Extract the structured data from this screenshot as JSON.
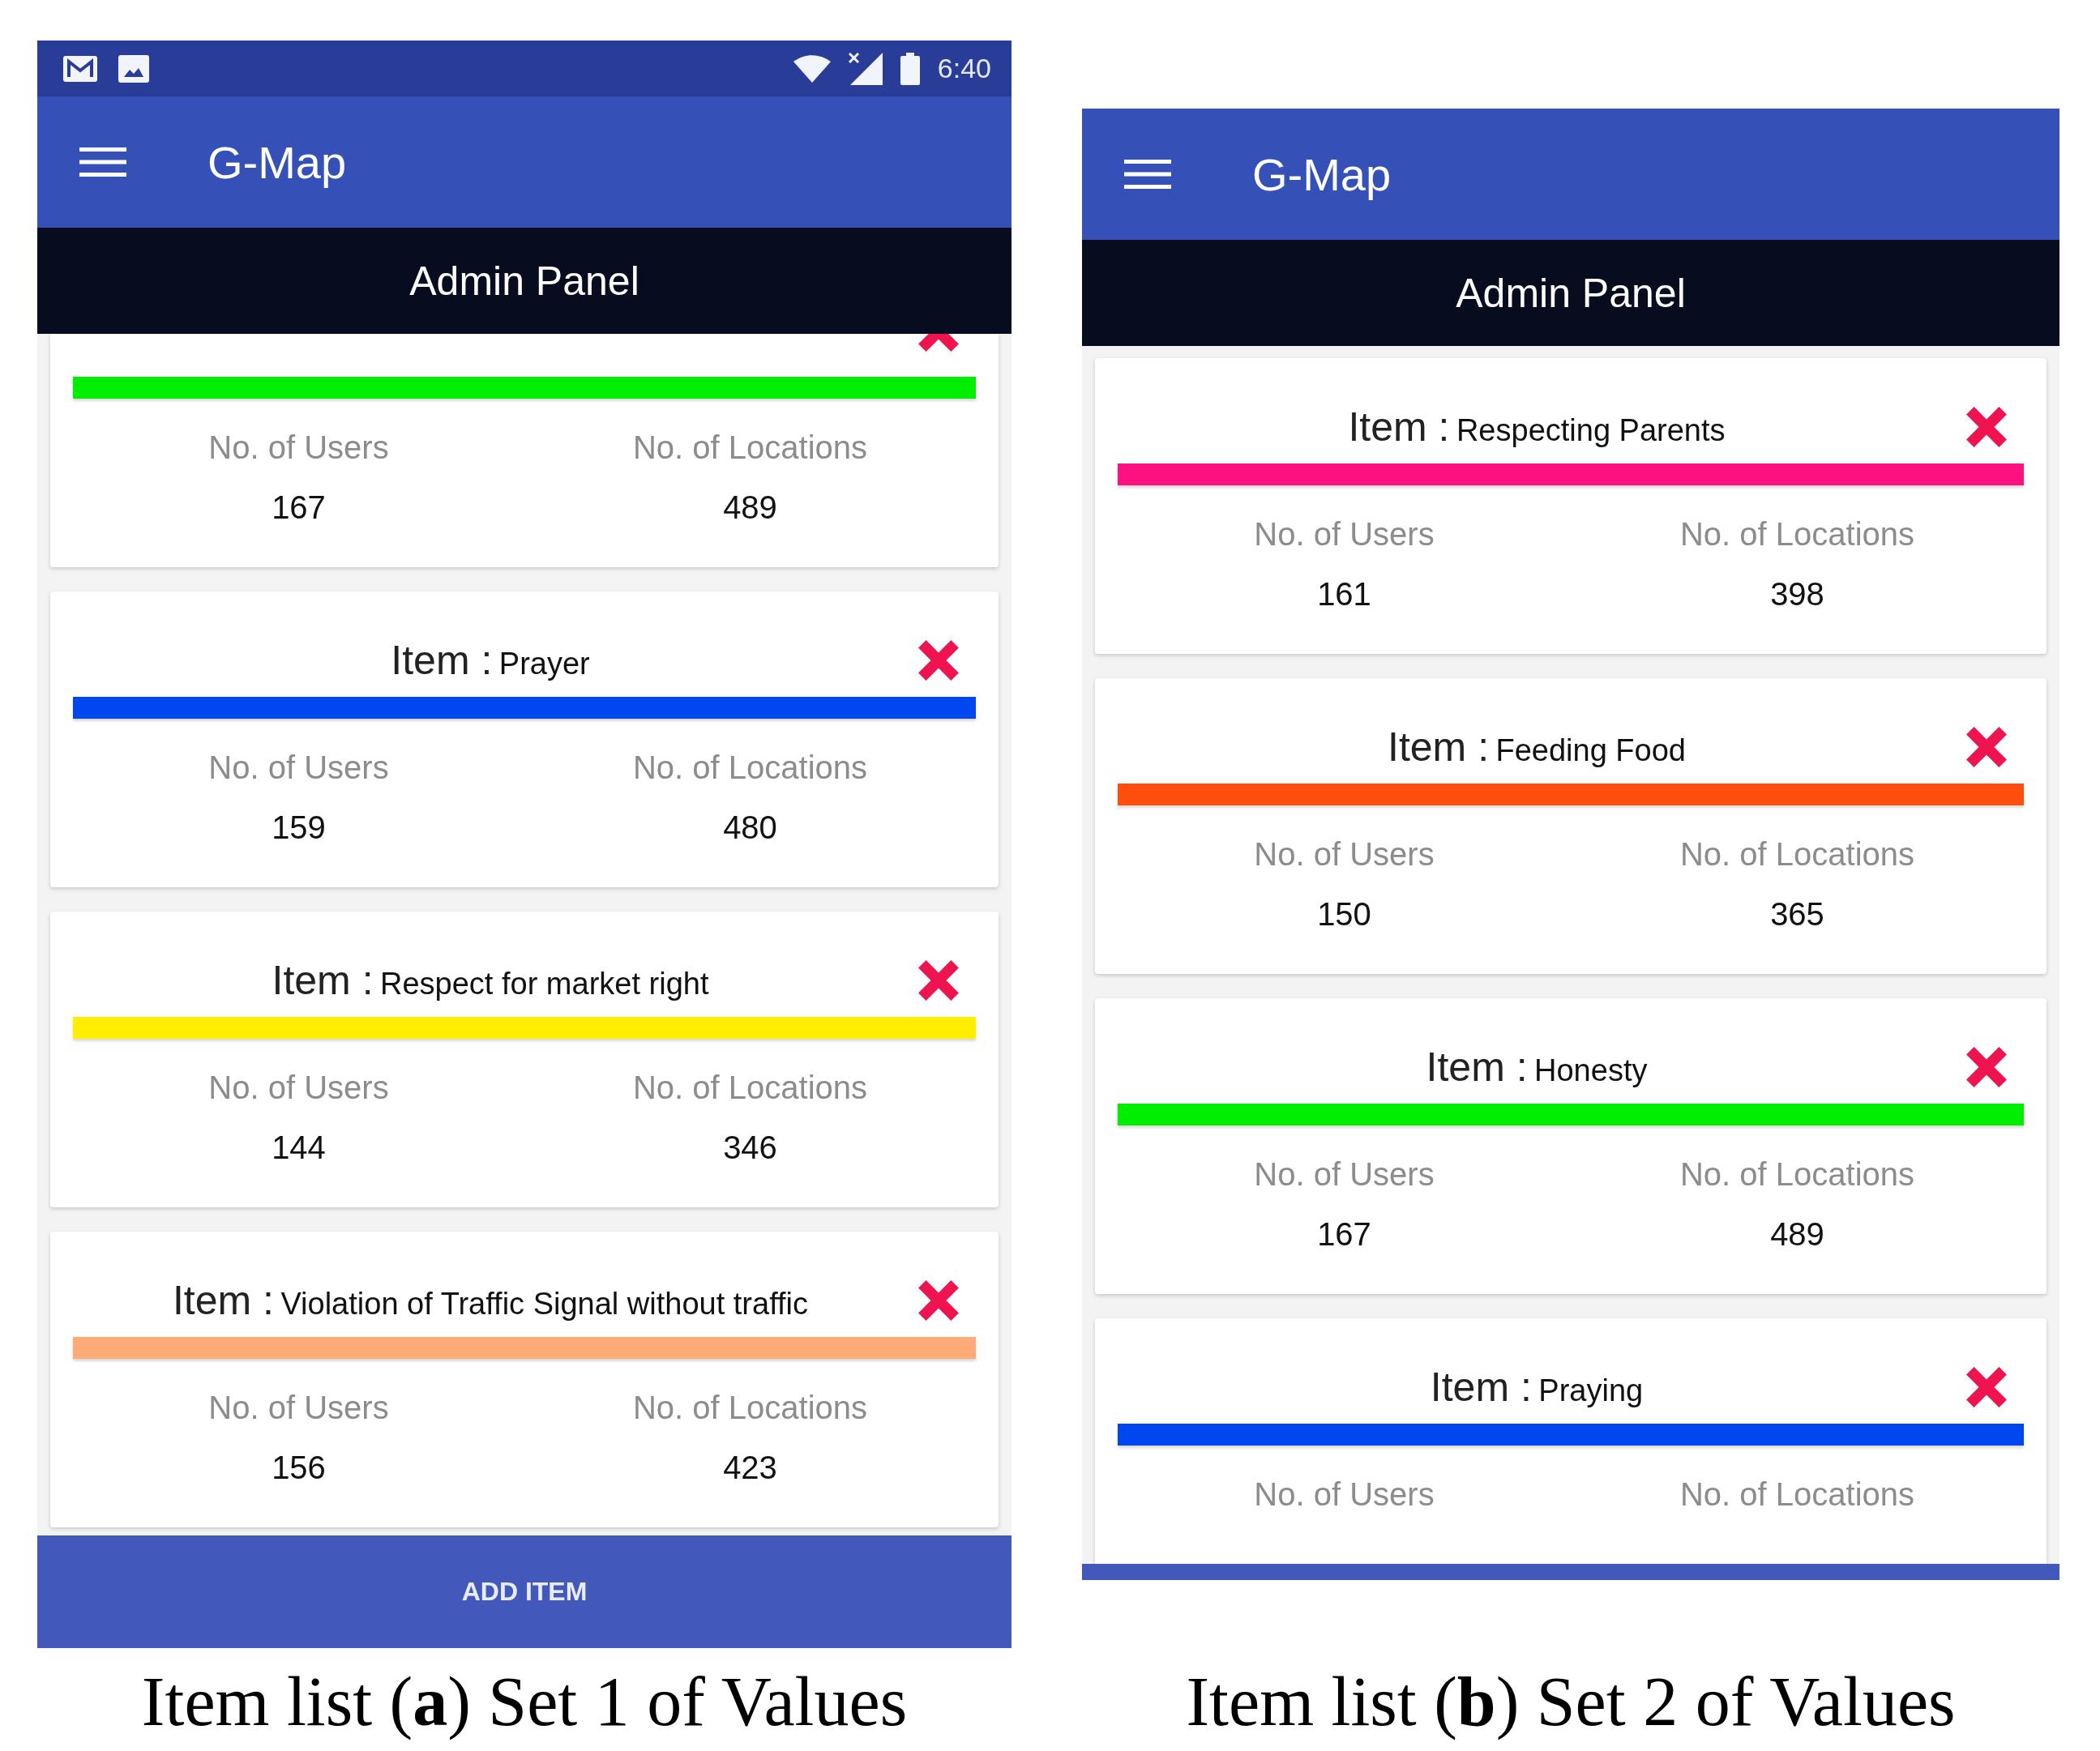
{
  "panels": [
    {
      "status_bar": {
        "time": "6:40"
      },
      "app_bar": {
        "title": "G-Map"
      },
      "header": "Admin Panel",
      "items": [
        {
          "kind": "top_cut",
          "color": "#00ee00",
          "stats": [
            {
              "label": "No. of Users",
              "value": "167"
            },
            {
              "label": "No. of Locations",
              "value": "489"
            }
          ]
        },
        {
          "kind": "whole",
          "label": "Item :",
          "name": "Prayer",
          "color": "#0047ef",
          "stats": [
            {
              "label": "No. of Users",
              "value": "159"
            },
            {
              "label": "No. of Locations",
              "value": "480"
            }
          ]
        },
        {
          "kind": "whole",
          "label": "Item :",
          "name": "Respect for market right",
          "color": "#ffee00",
          "stats": [
            {
              "label": "No. of Users",
              "value": "144"
            },
            {
              "label": "No. of Locations",
              "value": "346"
            }
          ]
        },
        {
          "kind": "whole",
          "label": "Item :",
          "name": "Violation of Traffic Signal without traffic",
          "color": "#ffaa77",
          "stats": [
            {
              "label": "No. of Users",
              "value": "156"
            },
            {
              "label": "No. of Locations",
              "value": "423"
            }
          ]
        }
      ],
      "footer": {
        "kind": "button",
        "label": "ADD ITEM"
      },
      "caption": "Item list (**a**) Set 1 of Values"
    },
    {
      "app_bar": {
        "title": "G-Map"
      },
      "header": "Admin Panel",
      "items": [
        {
          "kind": "whole",
          "label": "Item :",
          "name": "Respecting Parents",
          "color": "#ff1080",
          "stats": [
            {
              "label": "No. of Users",
              "value": "161"
            },
            {
              "label": "No. of Locations",
              "value": "398"
            }
          ]
        },
        {
          "kind": "whole",
          "label": "Item :",
          "name": "Feeding Food",
          "color": "#ff4d0d",
          "stats": [
            {
              "label": "No. of Users",
              "value": "150"
            },
            {
              "label": "No. of Locations",
              "value": "365"
            }
          ]
        },
        {
          "kind": "whole",
          "label": "Item :",
          "name": "Honesty",
          "color": "#00ee00",
          "stats": [
            {
              "label": "No. of Users",
              "value": "167"
            },
            {
              "label": "No. of Locations",
              "value": "489"
            }
          ]
        },
        {
          "kind": "bottom_cut",
          "label": "Item :",
          "name": "Praying",
          "color": "#0047ef",
          "stats": [
            {
              "label": "No. of Users"
            },
            {
              "label": "No. of Locations"
            }
          ]
        }
      ],
      "footer": {
        "kind": "strip"
      },
      "caption": "Item list (**b**) Set 2 of Values"
    }
  ]
}
